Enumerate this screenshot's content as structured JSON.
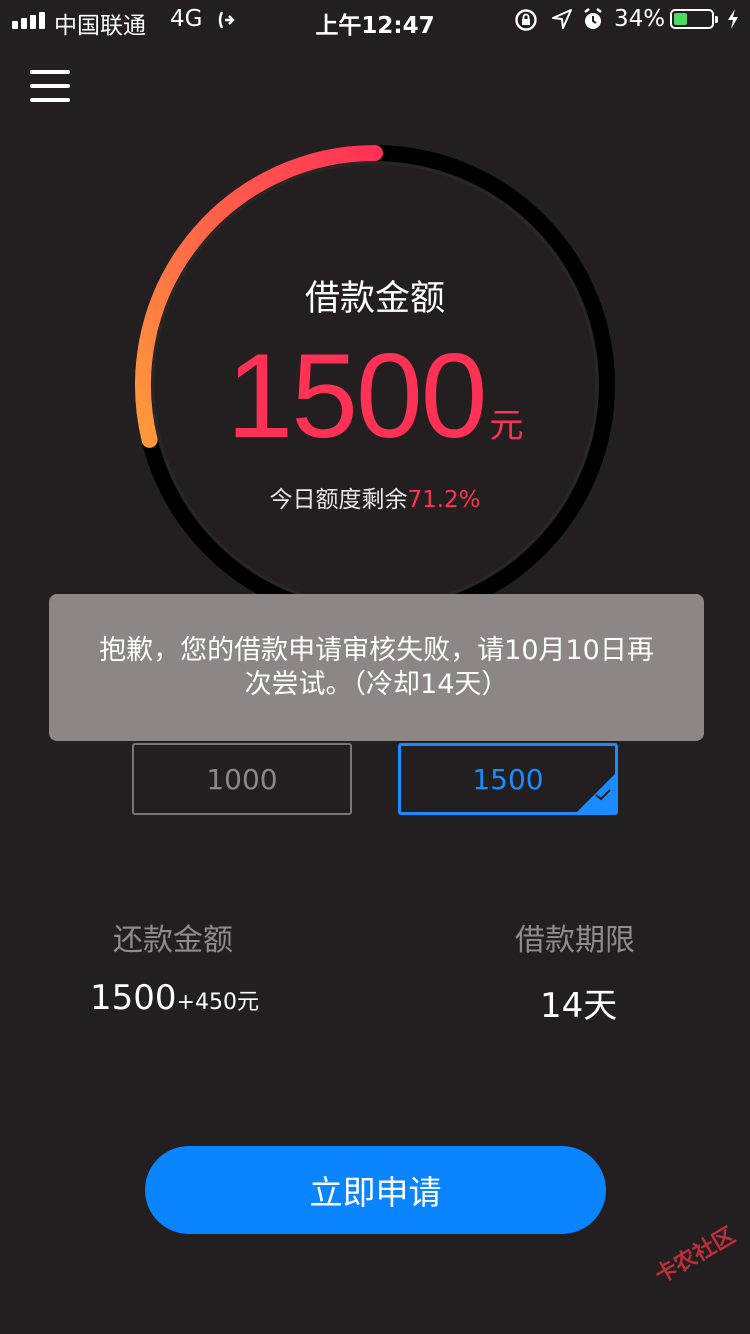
{
  "status_bar": {
    "carrier": "中国联通",
    "network": "4G",
    "time": "上午12:47",
    "battery_percent": "34%",
    "battery_level": 0.34,
    "icons": [
      "signal-icon",
      "hotspot-icon",
      "orientation-lock-icon",
      "location-icon",
      "alarm-icon",
      "battery-icon",
      "charging-icon"
    ]
  },
  "menu": {
    "icon": "hamburger-menu-icon"
  },
  "gauge": {
    "title": "借款金额",
    "amount": "1500",
    "unit": "元",
    "remaining_label": "今日额度剩余",
    "remaining_value": "71.2%",
    "progress_fraction": 0.288,
    "colors": {
      "arc_start": "#ff9a3c",
      "arc_end": "#ff3155",
      "track": "#000000"
    }
  },
  "options": [
    {
      "label": "1000",
      "selected": false
    },
    {
      "label": "1500",
      "selected": true
    }
  ],
  "toast": {
    "message_line1": "抱歉，您的借款申请审核失败，请10月10日再",
    "message_line2": "次尝试。（冷却14天）"
  },
  "repayment": {
    "label": "还款金额",
    "principal": "1500",
    "interest": "+450元"
  },
  "term": {
    "label": "借款期限",
    "value": "14天"
  },
  "apply_button": {
    "label": "立即申请"
  },
  "watermark": {
    "text": "卡农社区"
  },
  "colors": {
    "background": "#231f20",
    "accent_red": "#ff3155",
    "accent_blue": "#0a84ff",
    "toast_bg": "#8c8685"
  }
}
